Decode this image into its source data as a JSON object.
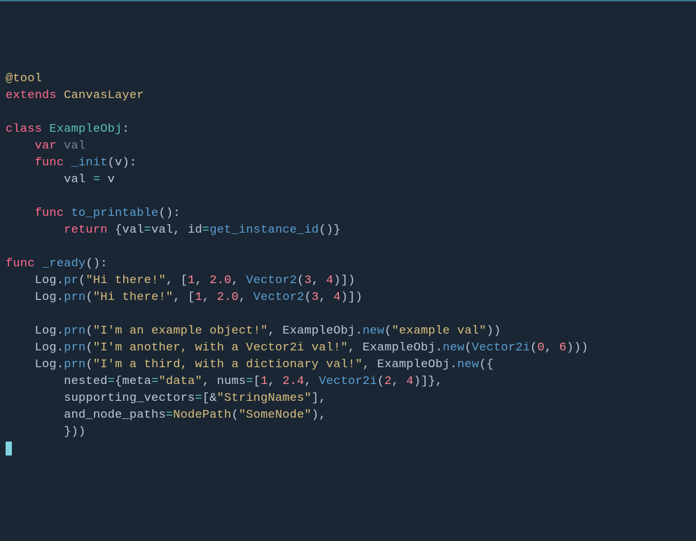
{
  "code": {
    "annotation": "@tool",
    "extends_kw": "extends",
    "extends_class": "CanvasLayer",
    "class_kw": "class",
    "class_name": "ExampleObj",
    "var_kw": "var",
    "var_name": "val",
    "func_kw": "func",
    "init_name": "_init",
    "init_param": "v",
    "init_body_lhs": "val",
    "init_body_rhs": "v",
    "to_printable_name": "to_printable",
    "return_kw": "return",
    "tp_key1": "val",
    "tp_val1": "val",
    "tp_key2": "id",
    "tp_call": "get_instance_id",
    "ready_name": "_ready",
    "log": "Log",
    "pr": "pr",
    "prn": "prn",
    "str_hi": "\"Hi there!\"",
    "num_1": "1",
    "num_2p0": "2.0",
    "vec2": "Vector2",
    "num_3": "3",
    "num_4": "4",
    "str_ex1": "\"I'm an example object!\"",
    "new": "new",
    "str_exval": "\"example val\"",
    "str_ex2": "\"I'm another, with a Vector2i val!\"",
    "vec2i": "Vector2i",
    "num_0": "0",
    "num_6": "6",
    "str_ex3": "\"I'm a third, with a dictionary val!\"",
    "nested_key": "nested",
    "meta_key": "meta",
    "str_data": "\"data\"",
    "nums_key": "nums",
    "num_2p4": "2.4",
    "num_2": "2",
    "supporting_key": "supporting_vectors",
    "str_stringnames": "\"StringNames\"",
    "paths_key": "and_node_paths",
    "nodepath": "NodePath",
    "str_somenode": "\"SomeNode\"",
    "amp": "&"
  }
}
